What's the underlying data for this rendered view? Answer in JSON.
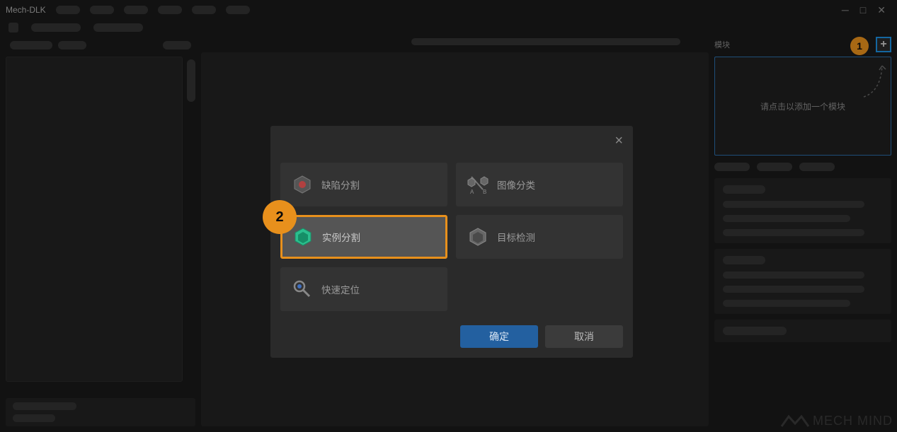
{
  "app_title": "Mech-DLK",
  "right": {
    "panel_label": "模块",
    "add_label": "+",
    "callout1": "1",
    "drop_hint": "请点击以添加一个模块"
  },
  "dialog": {
    "options": [
      {
        "label": "缺陷分割",
        "icon": "hex-defect"
      },
      {
        "label": "图像分类",
        "icon": "ab-classify"
      },
      {
        "label": "实例分割",
        "icon": "hex-instance"
      },
      {
        "label": "目标检测",
        "icon": "hex-detect"
      },
      {
        "label": "快速定位",
        "icon": "locate"
      }
    ],
    "callout2": "2",
    "ok_label": "确定",
    "cancel_label": "取消"
  },
  "watermark": "MECH MIND"
}
